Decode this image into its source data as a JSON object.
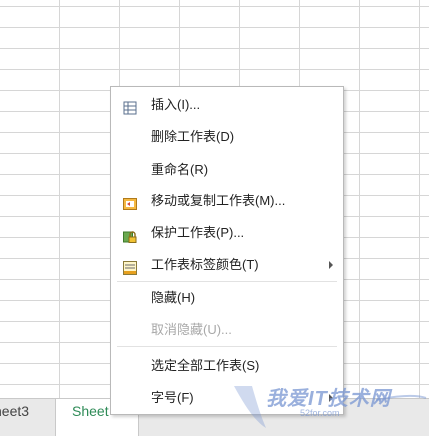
{
  "sheet_tabs": [
    {
      "label": "heet3",
      "active": false
    },
    {
      "label": "Sheet",
      "active": true
    }
  ],
  "context_menu": {
    "items": [
      {
        "label": "插入(I)...",
        "icon": "insert-table-icon",
        "enabled": true
      },
      {
        "label": "删除工作表(D)",
        "icon": "",
        "enabled": true
      },
      {
        "label": "重命名(R)",
        "icon": "",
        "enabled": true
      },
      {
        "label": "移动或复制工作表(M)...",
        "icon": "move-copy-sheet-icon",
        "enabled": true
      },
      {
        "label": "保护工作表(P)...",
        "icon": "protect-sheet-lock-icon",
        "enabled": true
      },
      {
        "label": "工作表标签颜色(T)",
        "icon": "tab-color-icon",
        "enabled": true,
        "submenu": true
      },
      {
        "label": "隐藏(H)",
        "icon": "",
        "enabled": true
      },
      {
        "label": "取消隐藏(U)...",
        "icon": "",
        "enabled": false
      },
      {
        "label": "选定全部工作表(S)",
        "icon": "",
        "enabled": true
      },
      {
        "label": "字号(F)",
        "icon": "",
        "enabled": true,
        "submenu": true
      }
    ]
  },
  "watermark": {
    "text": "我爱IT技术网",
    "subtext": "52for.com"
  },
  "colors": {
    "active_tab_text": "#2e8b57",
    "grid_line": "#d6d6d6",
    "disabled_text": "#a8a8a8"
  }
}
